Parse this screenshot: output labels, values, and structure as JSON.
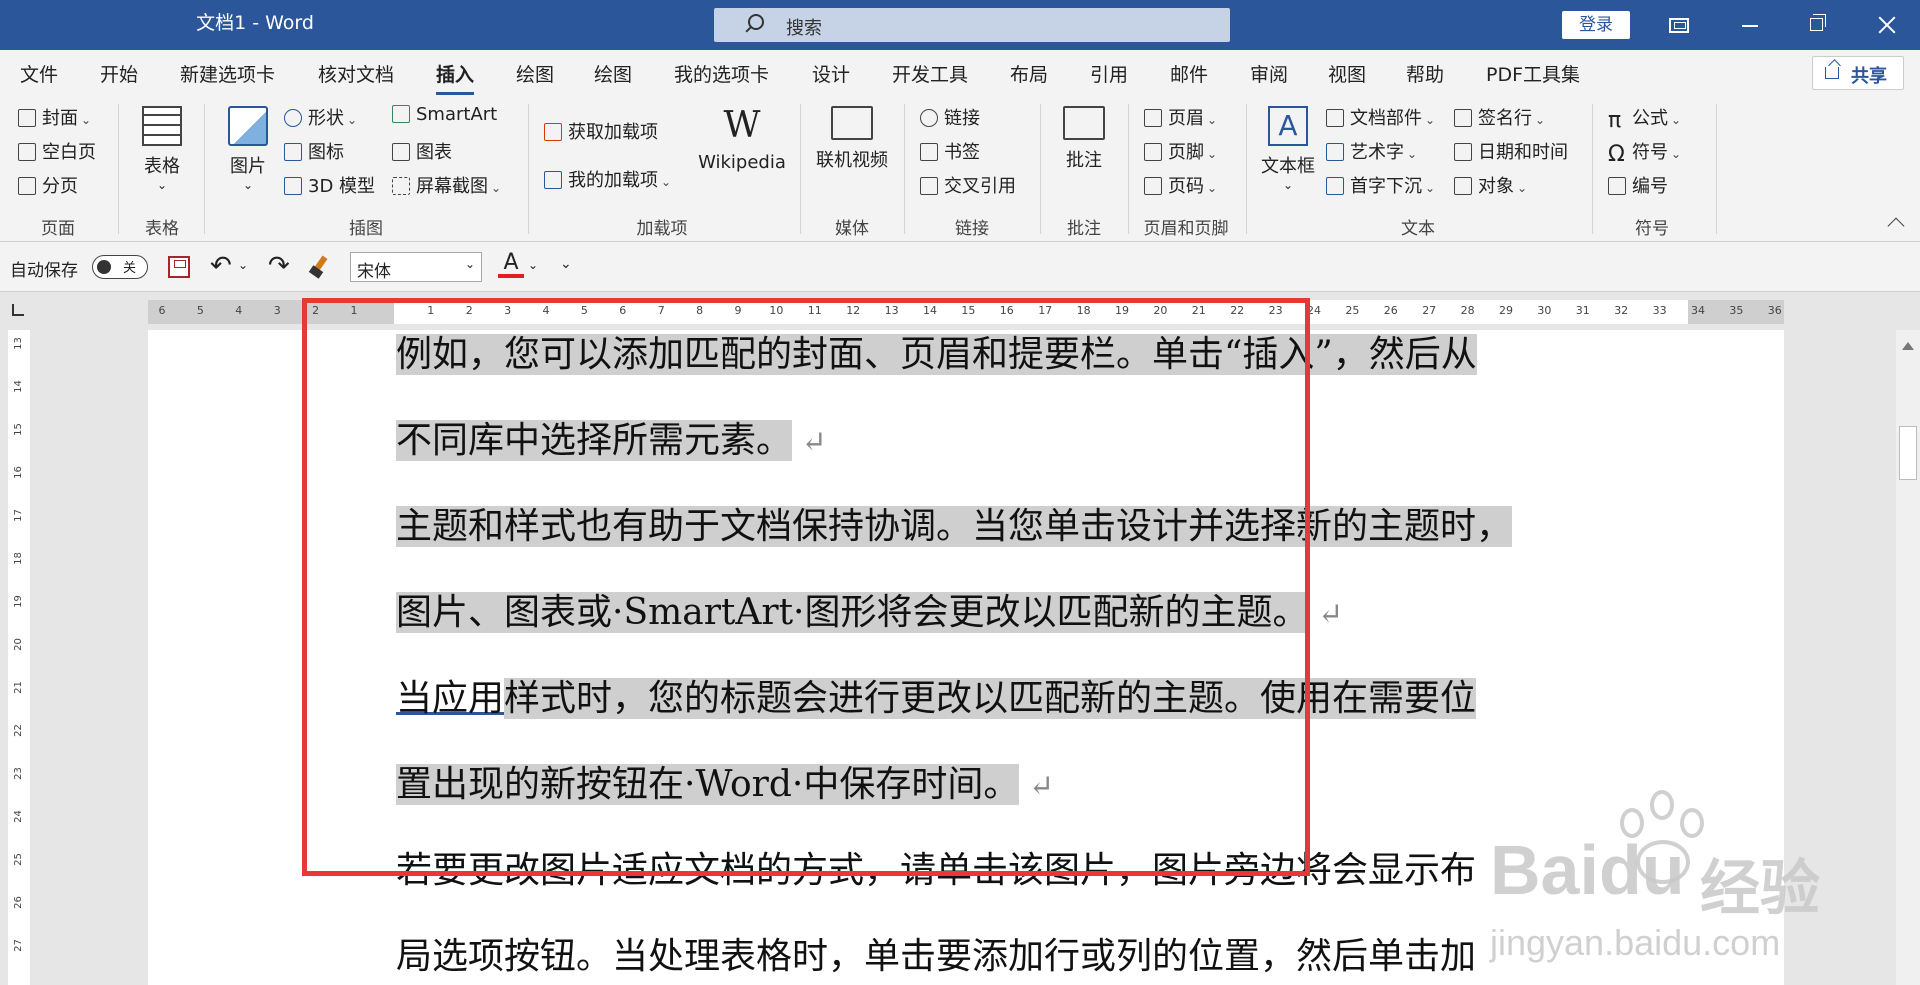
{
  "title_bar": {
    "doc_title": "文档1  -  Word",
    "search_placeholder": "搜索",
    "login": "登录"
  },
  "tabs": [
    "文件",
    "开始",
    "新建选项卡",
    "核对文档",
    "插入",
    "绘图",
    "绘图",
    "我的选项卡",
    "设计",
    "开发工具",
    "布局",
    "引用",
    "邮件",
    "审阅",
    "视图",
    "帮助",
    "PDF工具集"
  ],
  "active_tab": "插入",
  "share_label": "共享",
  "ribbon": {
    "pages": {
      "cover": "封面",
      "blank": "空白页",
      "break": "分页",
      "label": "页面"
    },
    "tables": {
      "table": "表格",
      "label": "表格"
    },
    "illustrations": {
      "picture": "图片",
      "shapes": "形状",
      "icons": "图标",
      "model3d": "3D 模型",
      "smartart": "SmartArt",
      "chart": "图表",
      "screenshot": "屏幕截图",
      "label": "插图"
    },
    "addins": {
      "get": "获取加载项",
      "mine": "我的加载项",
      "wikipedia": "Wikipedia",
      "label": "加载项"
    },
    "media": {
      "video": "联机视频",
      "label": "媒体"
    },
    "links": {
      "link": "链接",
      "bookmark": "书签",
      "crossref": "交叉引用",
      "label": "链接"
    },
    "comments": {
      "comment": "批注",
      "label": "批注"
    },
    "header_footer": {
      "header": "页眉",
      "footer": "页脚",
      "page_number": "页码",
      "label": "页眉和页脚"
    },
    "text": {
      "textbox": "文本框",
      "quickparts": "文档部件",
      "wordart": "艺术字",
      "dropcap": "首字下沉",
      "signature": "签名行",
      "datetime": "日期和时间",
      "object": "对象",
      "label": "文本"
    },
    "symbols": {
      "equation": "公式",
      "symbol": "符号",
      "number": "编号",
      "label": "符号"
    }
  },
  "qat": {
    "autosave": "自动保存",
    "toggle_state": "关",
    "font_name": "宋体",
    "font_color_letter": "A"
  },
  "rulers": {
    "h_numbers": [
      "6",
      "5",
      "4",
      "3",
      "2",
      "1",
      "",
      "1",
      "2",
      "3",
      "4",
      "5",
      "6",
      "7",
      "8",
      "9",
      "10",
      "11",
      "12",
      "13",
      "14",
      "15",
      "16",
      "17",
      "18",
      "19",
      "20",
      "21",
      "22",
      "23",
      "24",
      "25",
      "26",
      "27",
      "28",
      "29",
      "30",
      "31",
      "32",
      "33",
      "34",
      "35",
      "36"
    ],
    "v_numbers": [
      "13",
      "14",
      "15",
      "16",
      "17",
      "18",
      "19",
      "20",
      "21",
      "22",
      "23",
      "24",
      "25",
      "26",
      "27"
    ]
  },
  "document": {
    "lines": [
      {
        "pre": "",
        "hl": "例如，您可以添加匹配的封面、页眉和提要栏。单击“插入”，然后从",
        "post": "",
        "mark": ""
      },
      {
        "pre": "",
        "hl": "不同库中选择所需元素。",
        "post": "",
        "mark": "↵"
      },
      {
        "pre": "",
        "hl": "主题和样式也有助于文档保持协调。当您单击设计并选择新的主题时，",
        "post": "",
        "mark": ""
      },
      {
        "pre": "",
        "hl": "图片、图表或·SmartArt·图形将会更改以匹配新的主题。",
        "post": "",
        "mark": "↵"
      },
      {
        "pre": "当应用",
        "hl": "样式时，您的标题会进行更改以匹配新的主题。使用在需要位",
        "post": "",
        "mark": ""
      },
      {
        "pre": "",
        "hl": "置出现的新按钮在·Word·中保存时间。",
        "post": "",
        "mark": "↵"
      },
      {
        "pre": "若要更改图片适应文档的方式，请单击该图片，图片旁边将会显示布",
        "hl": "",
        "post": "",
        "mark": ""
      },
      {
        "pre": "局选项按钮。当处理表格时，单击要添加行或列的位置，然后单击加",
        "hl": "",
        "post": "",
        "mark": ""
      }
    ]
  },
  "watermark": {
    "brand": "Bai",
    "brand2": "du",
    "cn": "经验",
    "url": "jingyan.baidu.com"
  }
}
